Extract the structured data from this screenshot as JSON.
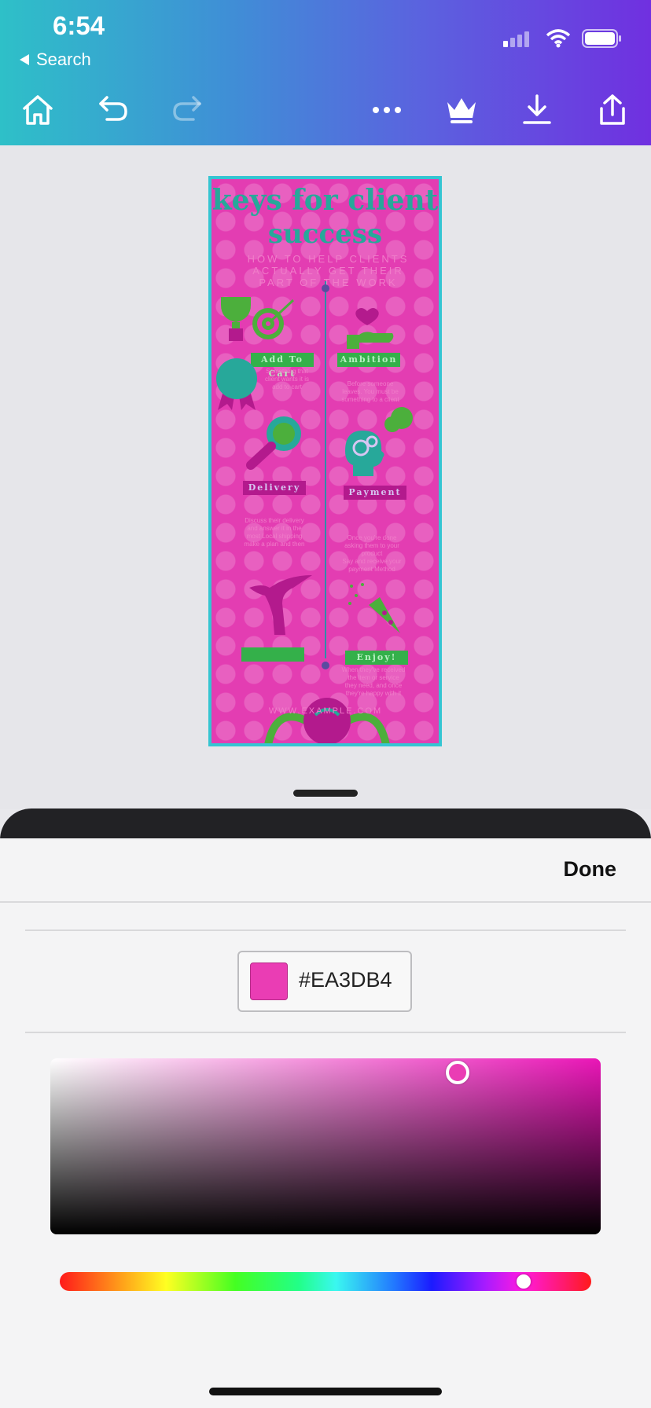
{
  "status_bar": {
    "time": "6:54",
    "back_label": "Search"
  },
  "toolbar": {
    "icons": [
      "home-icon",
      "undo-icon",
      "redo-icon",
      "more-icon",
      "crown-icon",
      "download-icon",
      "share-icon"
    ]
  },
  "design": {
    "title_line1": "keys for client",
    "title_line2": "success",
    "subtitle_line1": "HOW TO HELP CLIENTS",
    "subtitle_line2": "ACTUALLY GET THEIR",
    "subtitle_line3": "PART OF THE WORK",
    "labels": {
      "add_to_cart": "Add To Cart",
      "ambition": "Ambition",
      "delivery": "Delivery",
      "payment": "Payment",
      "enjoy": "Enjoy!"
    },
    "small_texts": {
      "left1": "Something that\nclient wants it is\nadd to cart",
      "right1": "Before someone\nleaves. You must be\nsomething to a client",
      "left2": "Discuss their delivery\nand answer it in the\nmost Local shipping\nmake a plan and then",
      "right2": "Once you're done\nasking them to your\nproduct\nSay and receive your\npayment Method",
      "right3": "When they've received\nthe item or service\nthey need, and once\nthey're happy with it"
    },
    "footer_url": "WWW.EXAMPLE.COM",
    "colors": {
      "background": "#E33DB2",
      "teal": "#27A89A",
      "green": "#34B04A",
      "magenta": "#B31A8D",
      "border": "#35C5D2"
    }
  },
  "color_panel": {
    "done_label": "Done",
    "hex_value": "#EA3DB4",
    "selected_color": "#EA3DB4",
    "saturation": 0.74,
    "brightness": 0.92,
    "hue_position": 0.873
  }
}
